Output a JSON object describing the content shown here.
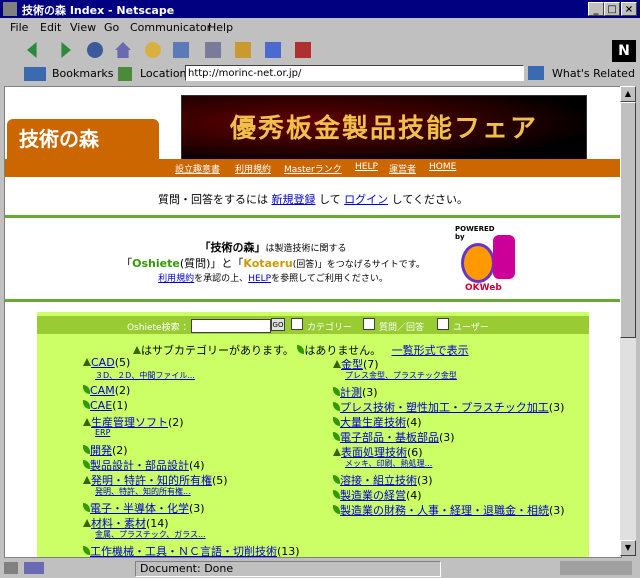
{
  "window": {
    "title": "技術の森 Index - Netscape"
  },
  "menu": [
    "File",
    "Edit",
    "View",
    "Go",
    "Communicator",
    "Help"
  ],
  "location": {
    "bookmarks_label": "Bookmarks",
    "location_label": "Location:",
    "url": "http://morinc-net.or.jp/",
    "related_label": "What's Related"
  },
  "status": {
    "text": "Document: Done"
  },
  "page": {
    "logo": "技術の森",
    "banner": "優秀板金製品技能フェア",
    "nav": [
      "設立趣意書",
      "利用規約",
      "Masterランク",
      "HELP",
      "運営者",
      "HOME"
    ],
    "login": {
      "pre": "質問・回答をするには",
      "register": "新規登録",
      "mid": "して",
      "login": "ログイン",
      "post": "してください。"
    },
    "intro": {
      "l1a": "「技術の森」",
      "l1b": "は製造技術に関する",
      "l2a": "「",
      "oshiete": "Oshiete",
      "l2b": "(質問)」と「",
      "kotaeru": "Kotaeru",
      "l2c": "(回答)」をつなげるサイトです。",
      "terms": "利用規約",
      "l3a": "を承認の上、",
      "help": "HELP",
      "l3b": "を参照してご利用ください。"
    },
    "okweb": {
      "powered": "POWERED",
      "by": "by",
      "brand": "OKWeb"
    },
    "search": {
      "label": "Oshiete検索 ：",
      "go": "GO",
      "opt1": "カテゴリー",
      "opt2": "質問／回答",
      "opt3": "ユーザー"
    },
    "legend": {
      "a": "はサブカテゴリーがあります。",
      "b": "はありません。",
      "list": "一覧形式で表示"
    },
    "left_cats": [
      {
        "name": "CAD",
        "count": "(5)",
        "sub": "３D、２D、中間ファイル..."
      },
      {
        "name": "CAM",
        "count": "(2)"
      },
      {
        "name": "CAE",
        "count": "(1)"
      },
      {
        "name": "生産管理ソフト",
        "count": "(2)",
        "sub": "ERP"
      },
      {
        "name": "開発",
        "count": "(2)"
      },
      {
        "name": "製品設計・部品設計",
        "count": "(4)"
      },
      {
        "name": "発明・特許・知的所有権",
        "count": "(5)",
        "sub": "発明、特許、知的所有権..."
      },
      {
        "name": "電子・半導体・化学",
        "count": "(3)"
      },
      {
        "name": "材料・素材",
        "count": "(14)",
        "sub": "金属、プラスチック、ガラス..."
      },
      {
        "name": "工作機械・工具・ＮＣ言語・切削技術",
        "count": "(13)"
      }
    ],
    "right_cats": [
      {
        "name": "金型",
        "count": "(7)",
        "sub": "プレス金型、プラスチック金型"
      },
      {
        "name": "計測",
        "count": "(3)"
      },
      {
        "name": "プレス技術・塑性加工・プラスチック加工",
        "count": "(3)"
      },
      {
        "name": "大量生産技術",
        "count": "(4)"
      },
      {
        "name": "電子部品・基板部品",
        "count": "(3)"
      },
      {
        "name": "表面処理技術",
        "count": "(6)",
        "sub": "メッキ、印刷、熱処理..."
      },
      {
        "name": "溶接・組立技術",
        "count": "(3)"
      },
      {
        "name": "製造業の経営",
        "count": "(4)"
      },
      {
        "name": "製造業の財務・人事・経理・退職金・相続",
        "count": "(3)"
      }
    ]
  }
}
